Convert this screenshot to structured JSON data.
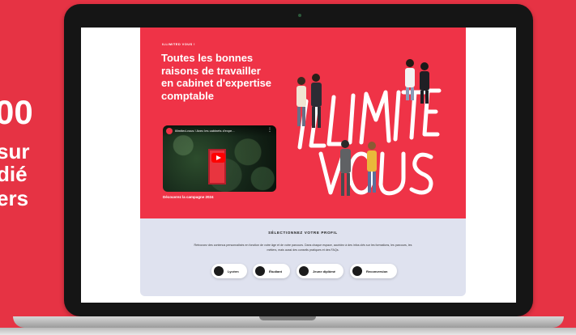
{
  "side": {
    "line_big": "00",
    "line1": "sur",
    "line2": "dié",
    "line3": "ers"
  },
  "hero": {
    "eyebrow": "ILLIMITED VOUS !",
    "headline": "Toutes les bonnes raisons de travailler en cabinet d'expertise comptable",
    "illustration_text": "ILLIMITED VOUS",
    "video": {
      "title": "Illimited-vous ! Avec les cabinets d'expe...",
      "play_icon": "youtube-play-icon"
    },
    "campaign_link": "Découvrez la campagne 2024"
  },
  "profile": {
    "title": "SÉLECTIONNEZ VOTRE PROFIL",
    "description": "Retrouvez des contenus personnalisés en fonction de votre âge et de votre parcours. Dans chaque espace, accédez à des infos clés sur les formations, les parcours, les métiers, mais aussi des conseils pratiques et des FAQs.",
    "options": [
      {
        "label": "Lycéen"
      },
      {
        "label": "Étudiant"
      },
      {
        "label": "Jeune diplômé"
      },
      {
        "label": "Reconversion"
      }
    ]
  },
  "colors": {
    "brand_red": "#ef3347",
    "background_red": "#e63344",
    "profile_bg": "#dfe2ef"
  }
}
